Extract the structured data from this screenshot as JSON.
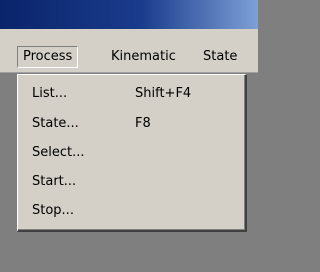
{
  "menubar": {
    "items": [
      "Process",
      "Kinematic",
      "State"
    ]
  },
  "dropdown": {
    "items": [
      {
        "label": "List...",
        "shortcut": "Shift+F4"
      },
      {
        "label": "State...",
        "shortcut": "F8"
      },
      {
        "label": "Select...",
        "shortcut": ""
      },
      {
        "label": "Start...",
        "shortcut": ""
      },
      {
        "label": "Stop...",
        "shortcut": ""
      }
    ]
  }
}
